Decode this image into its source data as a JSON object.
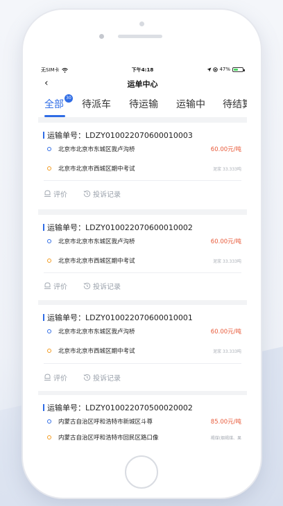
{
  "status_bar": {
    "carrier": "无SIM卡",
    "time": "下午4:18",
    "battery": "47%",
    "battery_level": 0.47
  },
  "nav": {
    "back_icon": "chevron-left-icon",
    "title": "运单中心"
  },
  "tabs": [
    {
      "label": "全部",
      "active": true,
      "badge": "30"
    },
    {
      "label": "待派车",
      "active": false
    },
    {
      "label": "待运输",
      "active": false
    },
    {
      "label": "运输中",
      "active": false
    },
    {
      "label": "待结算",
      "active": false
    }
  ],
  "orders": [
    {
      "number_label": "运输单号：",
      "number": "LDZY010022070600010003",
      "from": "北京市北京市东城区我卢沟桥",
      "to": "北京市北京市西城区期中考试",
      "price": "60.00元/吨",
      "cargo": "泥浆 33.333吨",
      "actions": [
        "评价",
        "投诉记录"
      ]
    },
    {
      "number_label": "运输单号：",
      "number": "LDZY010022070600010002",
      "from": "北京市北京市东城区我卢沟桥",
      "to": "北京市北京市西城区期中考试",
      "price": "60.00元/吨",
      "cargo": "泥浆 33.333吨",
      "actions": [
        "评价",
        "投诉记录"
      ]
    },
    {
      "number_label": "运输单号：",
      "number": "LDZY010022070600010001",
      "from": "北京市北京市东城区我卢沟桥",
      "to": "北京市北京市西城区期中考试",
      "price": "60.00元/吨",
      "cargo": "泥浆 33.333吨",
      "actions": [
        "评价",
        "投诉记录"
      ]
    },
    {
      "number_label": "运输单号：",
      "number": "LDZY010022070500020002",
      "from": "内蒙古自治区呼和浩特市新城区斗尊",
      "to": "内蒙古自治区呼和浩特市回民区路口像",
      "price": "85.00元/吨",
      "cargo": "褐煤(烟褐煤、果",
      "actions": []
    }
  ],
  "colors": {
    "accent": "#2f6ce5",
    "price": "#e85a3a",
    "origin_dot": "#2f6ce5",
    "destination_dot": "#f39a1e"
  }
}
